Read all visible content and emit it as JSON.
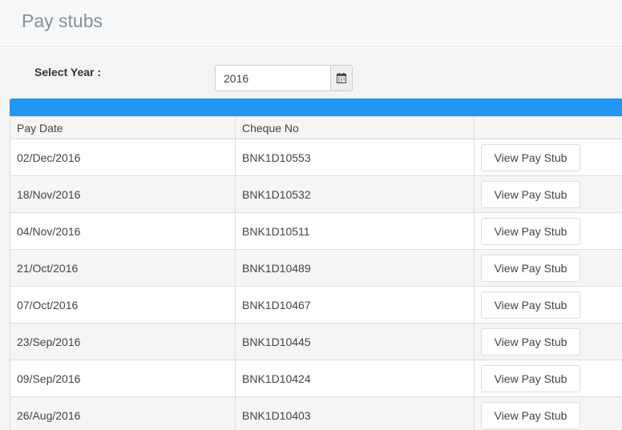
{
  "header": {
    "title": "Pay stubs"
  },
  "filters": {
    "year_label": "Select Year :",
    "year_value": "2016"
  },
  "table": {
    "columns": [
      "Pay Date",
      "Cheque No",
      ""
    ],
    "rows": [
      {
        "pay_date": "02/Dec/2016",
        "cheque_no": "BNK1D10553",
        "action": "View Pay Stub"
      },
      {
        "pay_date": "18/Nov/2016",
        "cheque_no": "BNK1D10532",
        "action": "View Pay Stub"
      },
      {
        "pay_date": "04/Nov/2016",
        "cheque_no": "BNK1D10511",
        "action": "View Pay Stub"
      },
      {
        "pay_date": "21/Oct/2016",
        "cheque_no": "BNK1D10489",
        "action": "View Pay Stub"
      },
      {
        "pay_date": "07/Oct/2016",
        "cheque_no": "BNK1D10467",
        "action": "View Pay Stub"
      },
      {
        "pay_date": "23/Sep/2016",
        "cheque_no": "BNK1D10445",
        "action": "View Pay Stub"
      },
      {
        "pay_date": "09/Sep/2016",
        "cheque_no": "BNK1D10424",
        "action": "View Pay Stub"
      },
      {
        "pay_date": "26/Aug/2016",
        "cheque_no": "BNK1D10403",
        "action": "View Pay Stub"
      }
    ]
  },
  "colors": {
    "accent": "#2196f3",
    "title_text": "#8a8f94"
  },
  "icons": {
    "calendar": "calendar-icon"
  }
}
